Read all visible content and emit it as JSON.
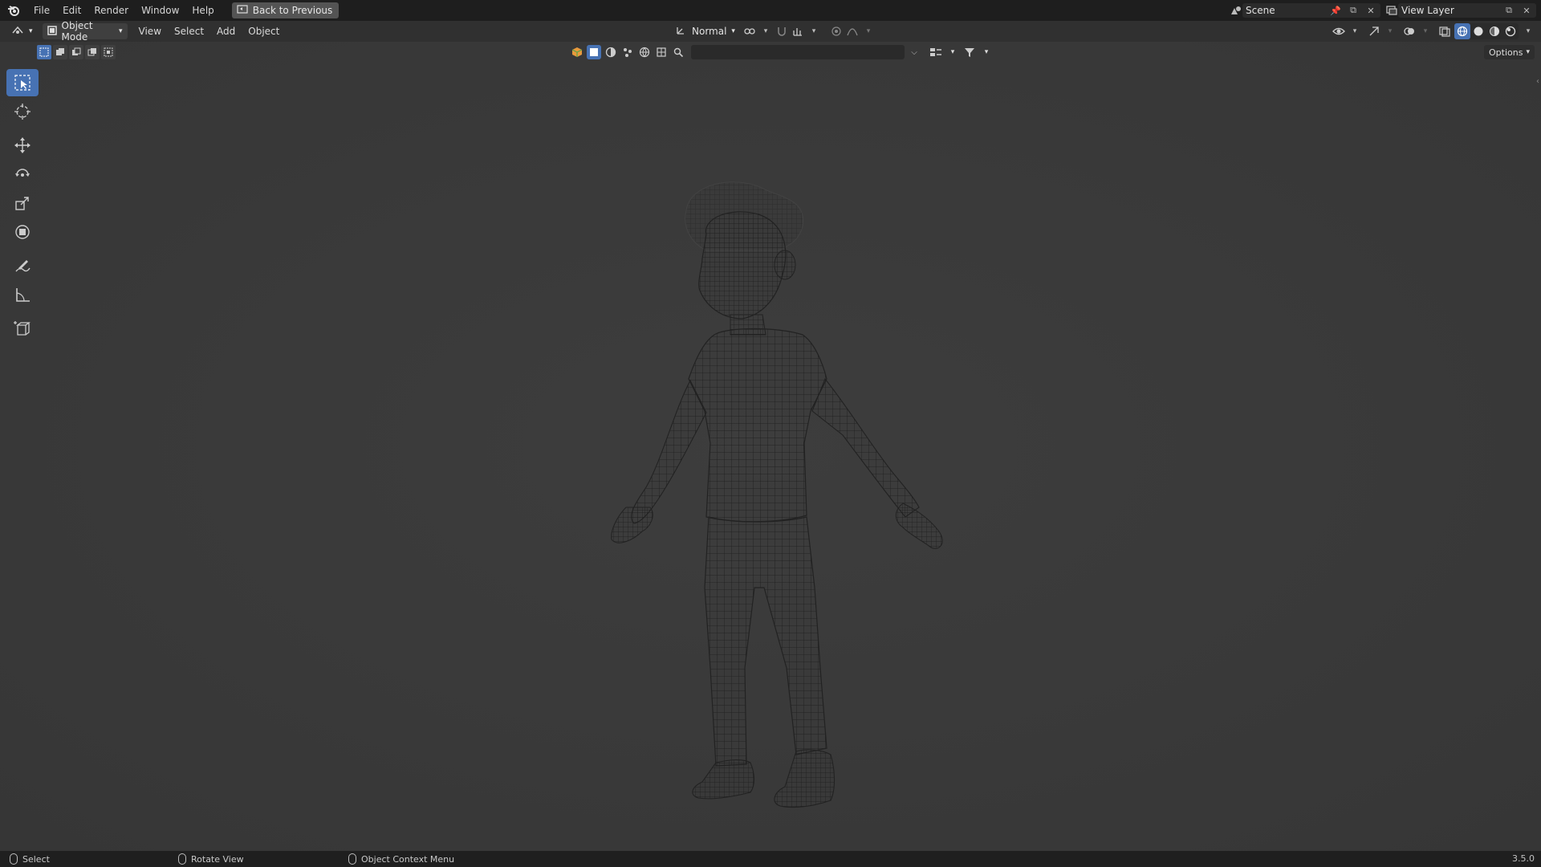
{
  "menubar": {
    "items": [
      "File",
      "Edit",
      "Render",
      "Window",
      "Help"
    ],
    "back_button": "Back to Previous",
    "scene_name": "Scene",
    "view_layer_name": "View Layer"
  },
  "header": {
    "mode": "Object Mode",
    "menus": [
      "View",
      "Select",
      "Add",
      "Object"
    ],
    "orientation": "Normal",
    "options_label": "Options"
  },
  "filter": {
    "search_placeholder": ""
  },
  "toolbar": {
    "tools": [
      "select-box",
      "cursor",
      "move",
      "rotate",
      "scale",
      "transform",
      "annotate",
      "measure",
      "add-cube"
    ],
    "active_tool": "select-box"
  },
  "statusbar": {
    "select_label": "Select",
    "rotate_label": "Rotate View",
    "context_label": "Object Context Menu",
    "version": "3.5.0"
  },
  "colors": {
    "accent": "#4772b3",
    "viewport_bg": "#3a3a3a",
    "wire": "#1a1a1a"
  }
}
